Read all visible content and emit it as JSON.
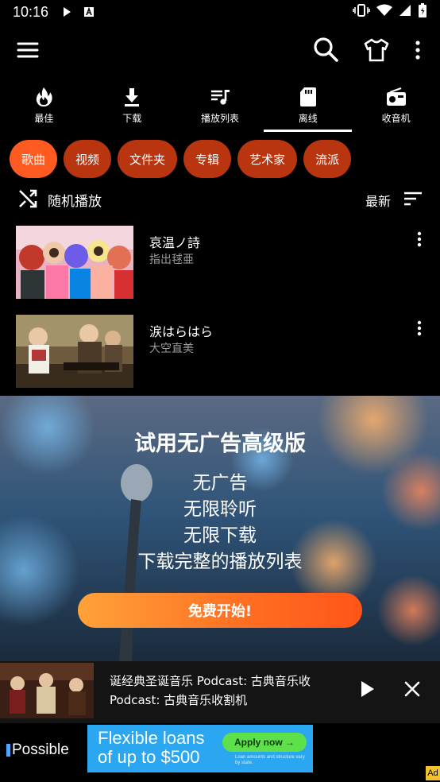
{
  "status_bar": {
    "time": "10:16"
  },
  "tabs": [
    {
      "label": "最佳",
      "icon": "flame-icon"
    },
    {
      "label": "下载",
      "icon": "download-icon"
    },
    {
      "label": "播放列表",
      "icon": "playlist-icon"
    },
    {
      "label": "离线",
      "icon": "sd-card-icon",
      "active": true
    },
    {
      "label": "收音机",
      "icon": "radio-icon"
    }
  ],
  "chips": [
    {
      "label": "歌曲",
      "active": true
    },
    {
      "label": "视频"
    },
    {
      "label": "文件夹"
    },
    {
      "label": "专辑"
    },
    {
      "label": "艺术家"
    },
    {
      "label": "流派"
    }
  ],
  "shuffle": {
    "label": "随机播放"
  },
  "sort": {
    "label": "最新"
  },
  "songs": [
    {
      "title": "哀温ノ詩",
      "artist": "指出毬亜"
    },
    {
      "title": "涙はらはら",
      "artist": "大空直美"
    }
  ],
  "promo": {
    "title": "试用无广告高级版",
    "lines": [
      "无广告",
      "无限聆听",
      "无限下载",
      "下载完整的播放列表"
    ],
    "cta": "免费开始!"
  },
  "player": {
    "line1": "诞经典圣诞音乐 Podcast: 古典音乐收",
    "line2": "Podcast: 古典音乐收割机"
  },
  "ad": {
    "brand": "Possible",
    "headline1": "Flexible loans",
    "headline2": "of up to $500",
    "button": "Apply now →",
    "fine_print": "Loan amounts and structure vary by state.",
    "badge": "Ad"
  },
  "colors": {
    "chip_active": "#ff5a1f",
    "chip": "#b8350f",
    "cta_start": "#ffa23a",
    "cta_end": "#ff5518",
    "ad_banner": "#2aa7f0"
  }
}
